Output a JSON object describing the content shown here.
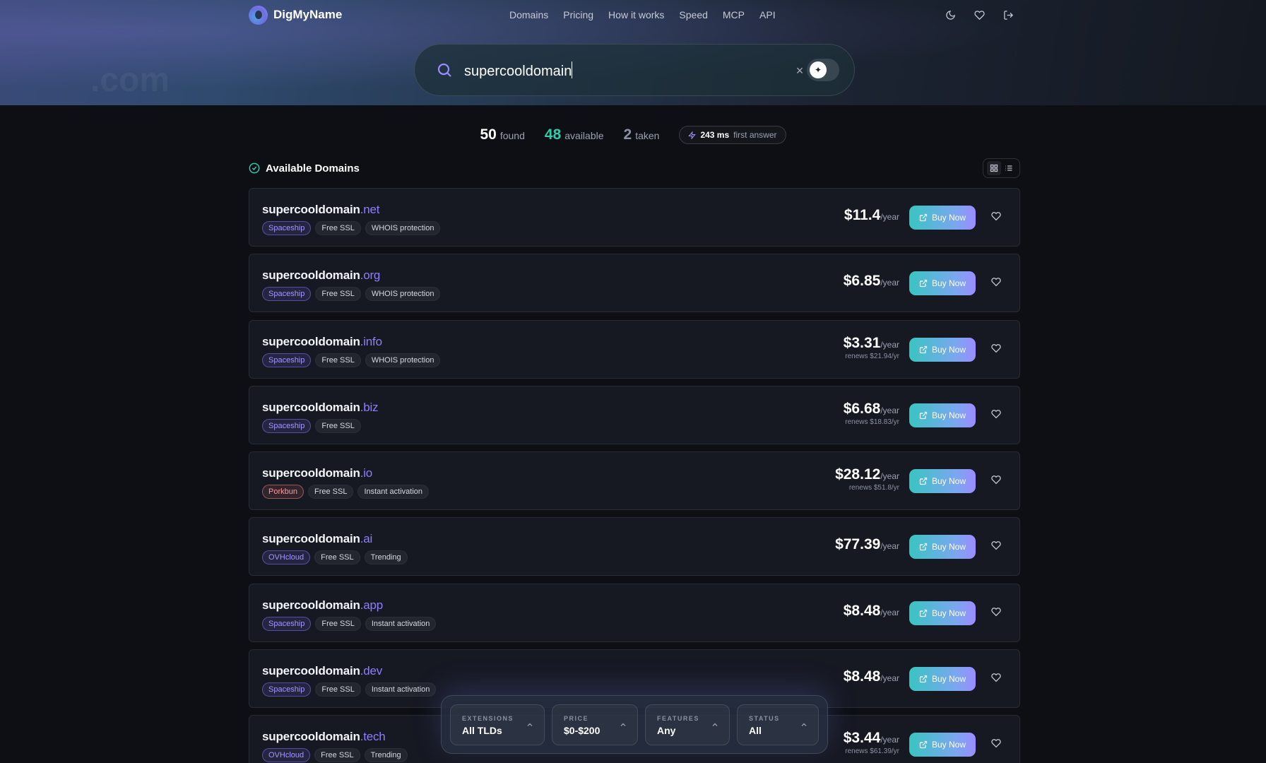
{
  "app": {
    "name": "DigMyName",
    "hero_ghost": ".com"
  },
  "nav": {
    "links": [
      "Domains",
      "Pricing",
      "How it works",
      "Speed",
      "MCP",
      "API"
    ],
    "icons": [
      "moon-icon",
      "heart-icon",
      "logout-icon"
    ]
  },
  "search": {
    "value": "supercooldomain",
    "clear": "×",
    "toggle_icon": "sparkle-icon"
  },
  "stats": {
    "found": {
      "value": "50",
      "label": "found"
    },
    "available": {
      "value": "48",
      "label": "available"
    },
    "taken": {
      "value": "2",
      "label": "taken"
    },
    "speed": {
      "value": "243 ms",
      "label": "first answer"
    }
  },
  "section": {
    "title": "Available Domains"
  },
  "buy_label": "Buy Now",
  "colors": {
    "accent": "#8f7dff",
    "available": "#35c9a8",
    "buy_from": "#38c5c2",
    "buy_to": "#9b8cff"
  },
  "domains": [
    {
      "name": "supercooldomain",
      "tld": ".net",
      "registrar": "Spaceship",
      "tags": [
        "Free SSL",
        "WHOIS protection"
      ],
      "price": "$11.4",
      "per": "/year",
      "renew": ""
    },
    {
      "name": "supercooldomain",
      "tld": ".org",
      "registrar": "Spaceship",
      "tags": [
        "Free SSL",
        "WHOIS protection"
      ],
      "price": "$6.85",
      "per": "/year",
      "renew": ""
    },
    {
      "name": "supercooldomain",
      "tld": ".info",
      "registrar": "Spaceship",
      "tags": [
        "Free SSL",
        "WHOIS protection"
      ],
      "price": "$3.31",
      "per": "/year",
      "renew": "renews $21.94/yr"
    },
    {
      "name": "supercooldomain",
      "tld": ".biz",
      "registrar": "Spaceship",
      "tags": [
        "Free SSL"
      ],
      "price": "$6.68",
      "per": "/year",
      "renew": "renews $18.83/yr"
    },
    {
      "name": "supercooldomain",
      "tld": ".io",
      "registrar": "Porkbun",
      "tags": [
        "Free SSL",
        "Instant activation"
      ],
      "price": "$28.12",
      "per": "/year",
      "renew": "renews $51.8/yr"
    },
    {
      "name": "supercooldomain",
      "tld": ".ai",
      "registrar": "OVHcloud",
      "tags": [
        "Free SSL",
        "Trending"
      ],
      "price": "$77.39",
      "per": "/year",
      "renew": ""
    },
    {
      "name": "supercooldomain",
      "tld": ".app",
      "registrar": "Spaceship",
      "tags": [
        "Free SSL",
        "Instant activation"
      ],
      "price": "$8.48",
      "per": "/year",
      "renew": ""
    },
    {
      "name": "supercooldomain",
      "tld": ".dev",
      "registrar": "Spaceship",
      "tags": [
        "Free SSL",
        "Instant activation"
      ],
      "price": "$8.48",
      "per": "/year",
      "renew": ""
    },
    {
      "name": "supercooldomain",
      "tld": ".tech",
      "registrar": "OVHcloud",
      "tags": [
        "Free SSL",
        "Trending"
      ],
      "price": "$3.44",
      "per": "/year",
      "renew": "renews $61.39/yr"
    }
  ],
  "filters": [
    {
      "label": "EXTENSIONS",
      "value": "All TLDs"
    },
    {
      "label": "PRICE",
      "value": "$0-$200"
    },
    {
      "label": "FEATURES",
      "value": "Any"
    },
    {
      "label": "STATUS",
      "value": "All"
    }
  ]
}
